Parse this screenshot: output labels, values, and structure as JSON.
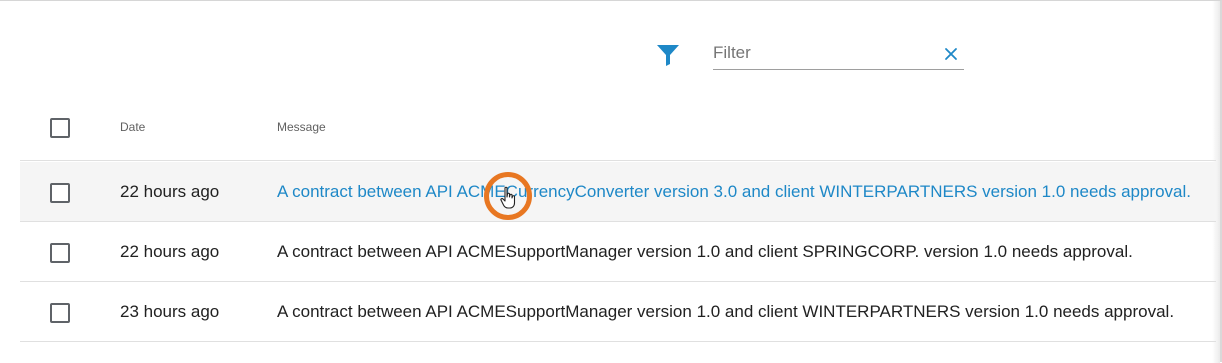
{
  "filter": {
    "placeholder": "Filter",
    "value": "",
    "icon": "filter-icon",
    "clear_icon": "close-icon",
    "accent_color": "#1e88c7"
  },
  "table": {
    "headers": {
      "date": "Date",
      "message": "Message"
    },
    "rows": [
      {
        "date": "22 hours ago",
        "message": "A contract between API ACMECurrencyConverter version 3.0 and client WINTERPARTNERS version 1.0 needs approval.",
        "hovered": true
      },
      {
        "date": "22 hours ago",
        "message": "A contract between API ACMESupportManager version 1.0 and client SPRINGCORP. version 1.0 needs approval.",
        "hovered": false
      },
      {
        "date": "23 hours ago",
        "message": "A contract between API ACMESupportManager version 1.0 and client WINTERPARTNERS version 1.0 needs approval.",
        "hovered": false
      }
    ]
  },
  "colors": {
    "link": "#1e88c7",
    "cursor_highlight": "#e87722",
    "row_hover_bg": "#f5f5f5"
  }
}
